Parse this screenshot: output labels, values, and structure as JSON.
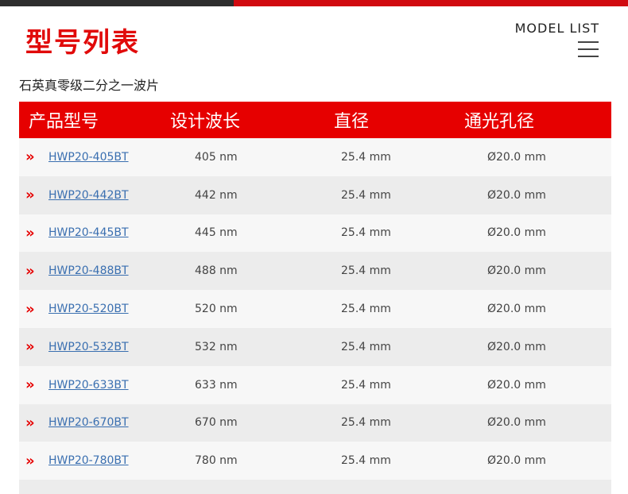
{
  "header": {
    "title": "型号列表",
    "model_list_label": "MODEL LIST"
  },
  "subtitle": "石英真零级二分之一波片",
  "table": {
    "columns": [
      "产品型号",
      "设计波长",
      "直径",
      "通光孔径"
    ],
    "arrow_glyph": "»",
    "rows": [
      {
        "model": "HWP20-405BT",
        "wavelength": "405 nm",
        "diameter": "25.4 mm",
        "aperture": "Ø20.0 mm"
      },
      {
        "model": "HWP20-442BT",
        "wavelength": "442 nm",
        "diameter": "25.4 mm",
        "aperture": "Ø20.0 mm"
      },
      {
        "model": "HWP20-445BT",
        "wavelength": "445 nm",
        "diameter": "25.4 mm",
        "aperture": "Ø20.0 mm"
      },
      {
        "model": "HWP20-488BT",
        "wavelength": "488 nm",
        "diameter": "25.4 mm",
        "aperture": "Ø20.0 mm"
      },
      {
        "model": "HWP20-520BT",
        "wavelength": "520 nm",
        "diameter": "25.4 mm",
        "aperture": "Ø20.0 mm"
      },
      {
        "model": "HWP20-532BT",
        "wavelength": "532 nm",
        "diameter": "25.4 mm",
        "aperture": "Ø20.0 mm"
      },
      {
        "model": "HWP20-633BT",
        "wavelength": "633 nm",
        "diameter": "25.4 mm",
        "aperture": "Ø20.0 mm"
      },
      {
        "model": "HWP20-670BT",
        "wavelength": "670 nm",
        "diameter": "25.4 mm",
        "aperture": "Ø20.0 mm"
      },
      {
        "model": "HWP20-780BT",
        "wavelength": "780 nm",
        "diameter": "25.4 mm",
        "aperture": "Ø20.0 mm"
      },
      {
        "model": "",
        "wavelength": "",
        "diameter": "",
        "aperture": ""
      }
    ]
  },
  "colors": {
    "accent_red": "#e60000",
    "link_blue": "#3a6fb0",
    "top_bar_dark": "#2e2e2e"
  },
  "icons": {
    "menu": "hamburger-icon",
    "row_marker": "double-chevron-right-icon"
  }
}
